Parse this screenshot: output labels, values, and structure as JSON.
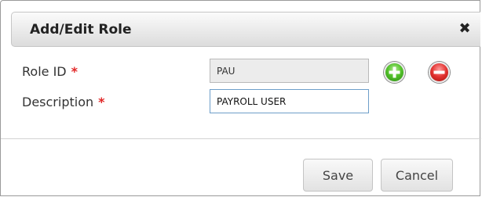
{
  "dialog": {
    "title": "Add/Edit Role",
    "close_label": "✖"
  },
  "form": {
    "role_id": {
      "label": "Role ID",
      "required_marker": "*",
      "value": "PAU"
    },
    "description": {
      "label": "Description",
      "required_marker": "*",
      "value": "PAYROLL USER"
    }
  },
  "actions": {
    "add_icon": "plus-circle-icon",
    "remove_icon": "minus-circle-icon"
  },
  "footer": {
    "save_label": "Save",
    "cancel_label": "Cancel"
  },
  "colors": {
    "required": "#e22727",
    "add": "#55c22c",
    "remove": "#e2312f"
  }
}
